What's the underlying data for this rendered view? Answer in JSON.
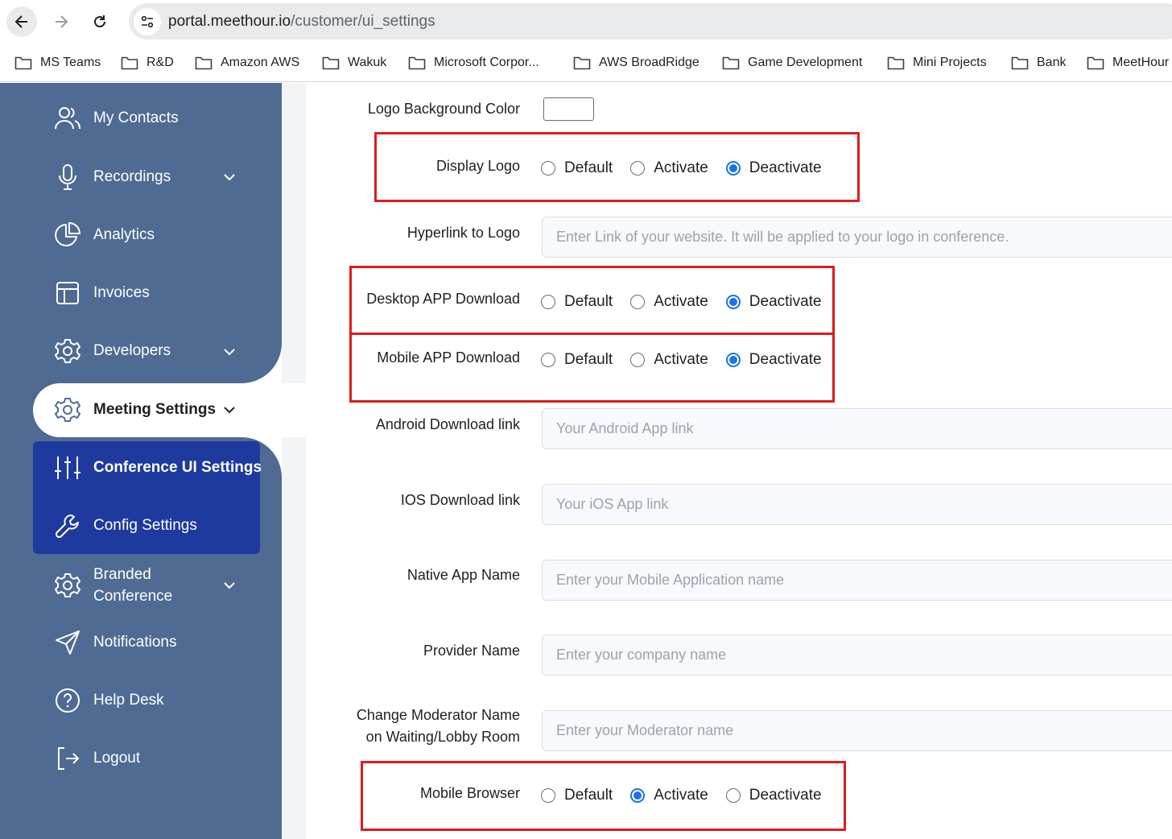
{
  "browser": {
    "url_host": "portal.meethour.io",
    "url_path": "/customer/ui_settings",
    "bookmarks": [
      "MS Teams",
      "R&D",
      "Amazon AWS",
      "Wakuk",
      "Microsoft Corpor...",
      "AWS BroadRidge",
      "Game Development",
      "Mini Projects",
      "Bank",
      "MeetHour"
    ]
  },
  "sidebar": {
    "items": [
      {
        "label": "My Contacts",
        "icon": "contacts-icon"
      },
      {
        "label": "Recordings",
        "icon": "microphone-icon"
      },
      {
        "label": "Analytics",
        "icon": "pie-chart-icon"
      },
      {
        "label": "Invoices",
        "icon": "invoice-icon"
      },
      {
        "label": "Developers",
        "icon": "gear-icon"
      },
      {
        "label": "Meeting Settings",
        "icon": "gear-icon"
      },
      {
        "label": "Conference UI Settings",
        "icon": "sliders-icon"
      },
      {
        "label": "Config Settings",
        "icon": "wrench-icon"
      },
      {
        "label": "Branded",
        "label2": "Conference",
        "icon": "gear-icon"
      },
      {
        "label": "Notifications",
        "icon": "send-icon"
      },
      {
        "label": "Help Desk",
        "icon": "help-icon"
      },
      {
        "label": "Logout",
        "icon": "logout-icon"
      }
    ]
  },
  "form": {
    "logo_bg_color": {
      "label": "Logo Background Color",
      "value": "#ffffff"
    },
    "radio_options": [
      "Default",
      "Activate",
      "Deactivate"
    ],
    "display_logo": {
      "label": "Display Logo",
      "selected": "Deactivate"
    },
    "hyperlink_logo": {
      "label": "Hyperlink to Logo",
      "placeholder": "Enter Link of your website. It will be applied to your logo in conference."
    },
    "desktop_app": {
      "label": "Desktop APP Download",
      "selected": "Deactivate"
    },
    "mobile_app": {
      "label": "Mobile APP Download",
      "selected": "Deactivate"
    },
    "android_link": {
      "label": "Android Download link",
      "placeholder": "Your Android App link"
    },
    "ios_link": {
      "label": "IOS Download link",
      "placeholder": "Your iOS App link"
    },
    "native_app_name": {
      "label": "Native App Name",
      "placeholder": "Enter your Mobile Application name"
    },
    "provider_name": {
      "label": "Provider Name",
      "placeholder": "Enter your company name"
    },
    "moderator_name": {
      "label1": "Change Moderator Name",
      "label2": "on Waiting/Lobby Room",
      "placeholder": "Enter your Moderator name"
    },
    "mobile_browser": {
      "label": "Mobile Browser",
      "selected": "Activate"
    }
  },
  "colors": {
    "sidebar": "#4f6b93",
    "submenu": "#1e3a9e",
    "accent": "#1a73e8",
    "highlight": "#e01b1b"
  }
}
